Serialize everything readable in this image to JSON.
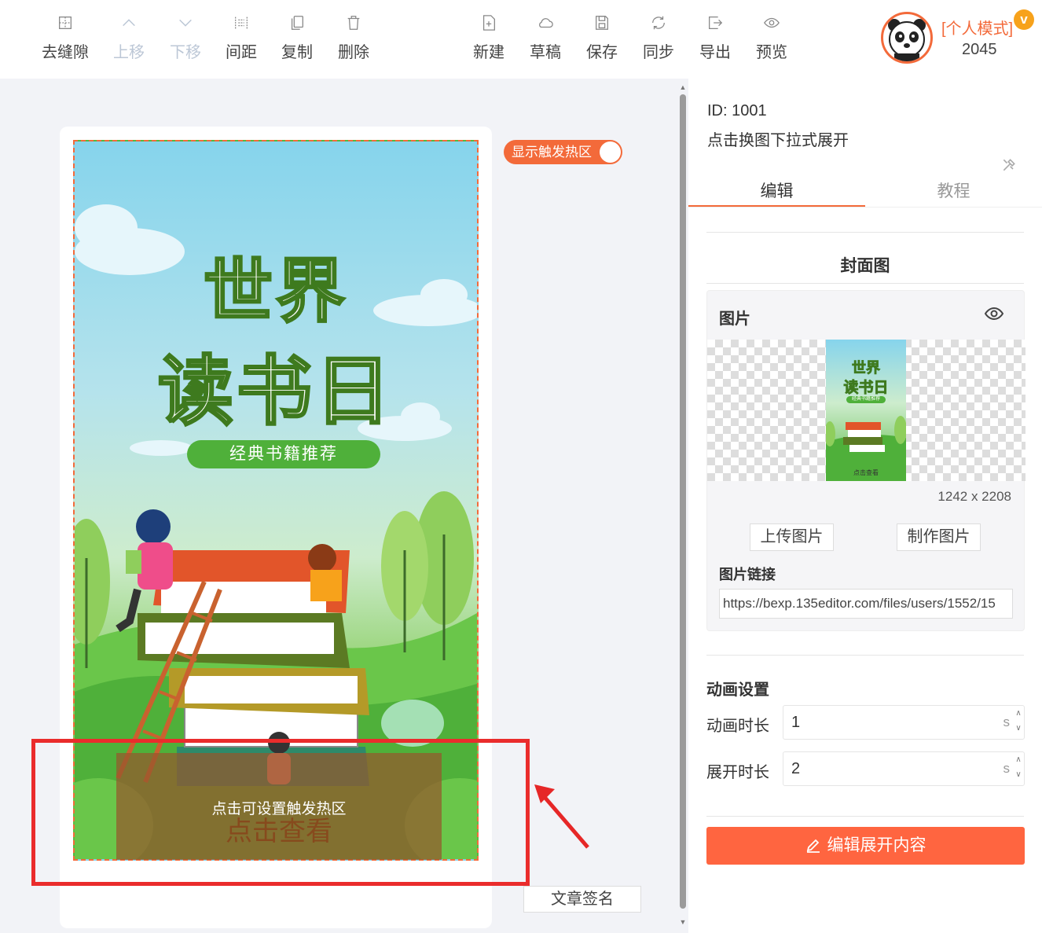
{
  "toolbar": {
    "left_items": [
      {
        "label": "去缝隙",
        "icon": "remove-gap-icon",
        "enabled": true
      },
      {
        "label": "上移",
        "icon": "chevron-up-icon",
        "enabled": false
      },
      {
        "label": "下移",
        "icon": "chevron-down-icon",
        "enabled": false
      },
      {
        "label": "间距",
        "icon": "spacing-icon",
        "enabled": true
      },
      {
        "label": "复制",
        "icon": "copy-icon",
        "enabled": true
      },
      {
        "label": "删除",
        "icon": "trash-icon",
        "enabled": true
      }
    ],
    "right_items": [
      {
        "label": "新建",
        "icon": "new-file-icon"
      },
      {
        "label": "草稿",
        "icon": "cloud-icon"
      },
      {
        "label": "保存",
        "icon": "save-icon"
      },
      {
        "label": "同步",
        "icon": "sync-icon"
      },
      {
        "label": "导出",
        "icon": "export-icon"
      },
      {
        "label": "预览",
        "icon": "eye-icon"
      }
    ]
  },
  "user": {
    "mode": "[个人模式]",
    "badge": "v",
    "number": "2045"
  },
  "canvas": {
    "toggle_label": "显示触发热区",
    "toggle_on": true,
    "poster": {
      "title_line1": "世界",
      "title_line2": "读书日",
      "subtitle": "经典书籍推荐"
    },
    "hotzone_label": "点击可设置触发热区",
    "hotzone_sub": "点击查看",
    "signature_button": "文章签名"
  },
  "panel": {
    "id_text": "ID: 1001",
    "description": "点击换图下拉式展开",
    "tabs": [
      {
        "label": "编辑",
        "active": true
      },
      {
        "label": "教程",
        "active": false
      }
    ],
    "cover_title": "封面图",
    "image_section": {
      "header": "图片",
      "thumb_title_line1": "世界",
      "thumb_title_line2": "读书日",
      "thumb_subtitle": "经典书籍推荐",
      "thumb_bottom": "点击查看",
      "dimensions": "1242 x 2208",
      "upload_button": "上传图片",
      "make_button": "制作图片",
      "link_label": "图片链接",
      "link_value": "https://bexp.135editor.com/files/users/1552/15"
    },
    "animation": {
      "title": "动画设置",
      "duration_label": "动画时长",
      "duration_value": "1",
      "expand_label": "展开时长",
      "expand_value": "2",
      "unit": "s"
    },
    "edit_button": "编辑展开内容"
  },
  "colors": {
    "accent": "#f36a3a",
    "primary_button": "#ff6540",
    "highlight_frame": "#ea2c2c",
    "vip_badge": "#f7a21b"
  }
}
